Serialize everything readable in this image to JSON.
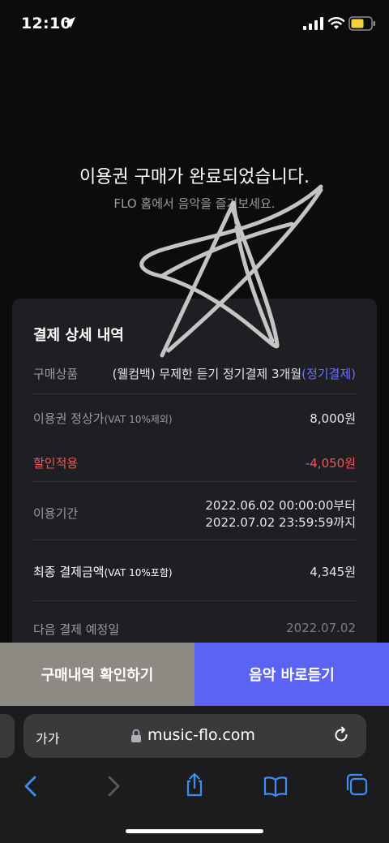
{
  "status_bar": {
    "time": "12:10"
  },
  "heading": {
    "title": "이용권 구매가 완료되었습니다.",
    "subtitle": "FLO 홈에서 음악을 즐겨보세요."
  },
  "card": {
    "title": "결제 상세 내역",
    "rows": {
      "product": {
        "label": "구매상품",
        "value": "(웰컴백) 무제한 듣기 정기결제 3개월",
        "tag": "(정기결제)"
      },
      "regular_price": {
        "label": "이용권 정상가",
        "note": "(VAT 10%제외)",
        "value": "8,000원"
      },
      "discount": {
        "label": "할인적용",
        "value": "-4,050원"
      },
      "period": {
        "label": "이용기간",
        "from": "2022.06.02 00:00:00부터",
        "to": "2022.07.02 23:59:59까지"
      },
      "final_amount": {
        "label": "최종 결제금액",
        "note": "(VAT 10%포함)",
        "value": "4,345원"
      },
      "next_payment": {
        "label": "다음 결제 예정일",
        "value": "2022.07.02"
      }
    }
  },
  "actions": {
    "history_label": "구매내역 확인하기",
    "play_label": "음악 바로듣기"
  },
  "browser": {
    "text_size_label": "가가",
    "url": "music-flo.com"
  },
  "colors": {
    "background": "#0c0c0d",
    "card": "#1f1f23",
    "accent": "#6b72ff",
    "discount": "#e8595b",
    "history_button": "#8c8a82",
    "play_button": "#5b63f5"
  }
}
